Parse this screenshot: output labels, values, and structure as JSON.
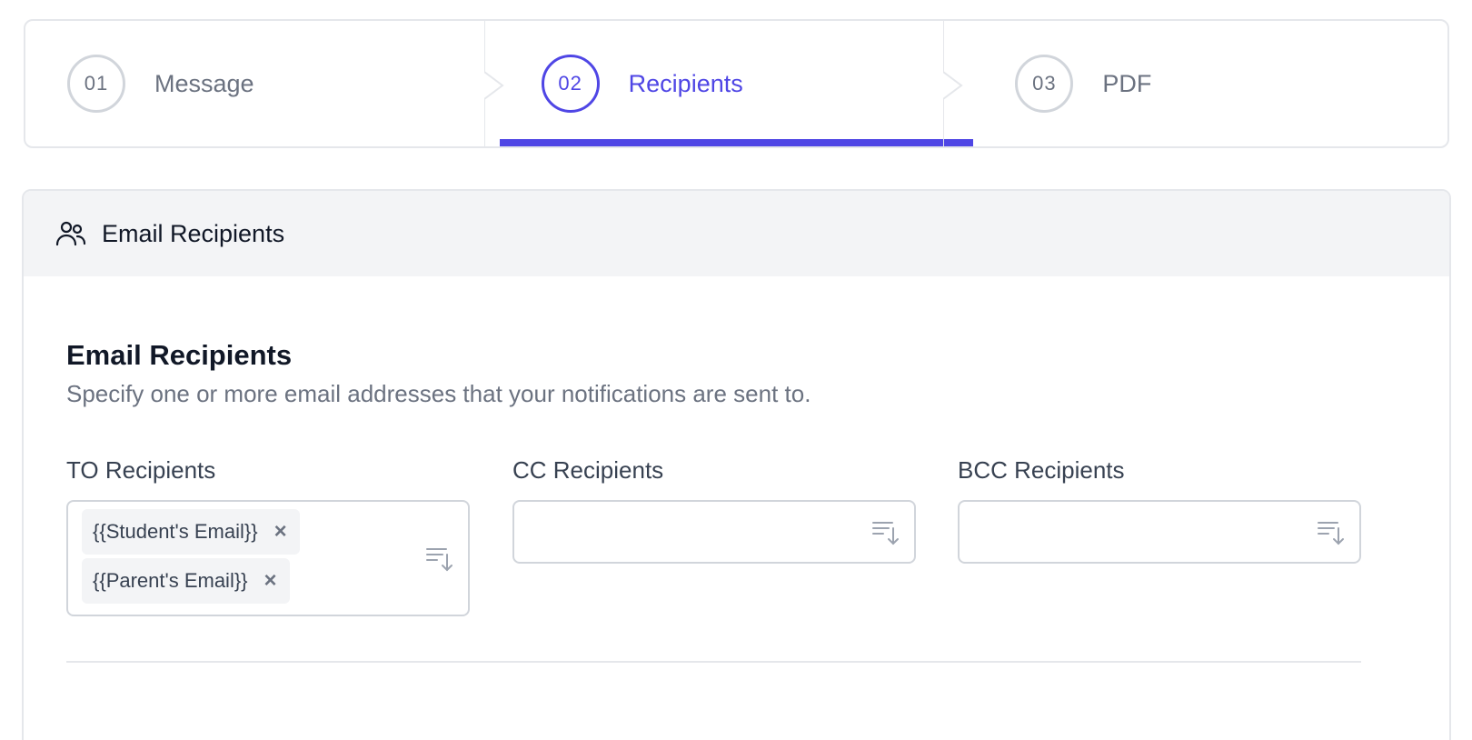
{
  "stepper": {
    "steps": [
      {
        "number": "01",
        "label": "Message",
        "active": false
      },
      {
        "number": "02",
        "label": "Recipients",
        "active": true
      },
      {
        "number": "03",
        "label": "PDF",
        "active": false
      }
    ],
    "accent_color": "#4f46e5"
  },
  "panel": {
    "header_icon": "users-icon",
    "header_title": "Email Recipients",
    "section_title": "Email Recipients",
    "section_description": "Specify one or more email addresses that your notifications are sent to."
  },
  "fields": {
    "to": {
      "label": "TO Recipients",
      "chips": [
        "{{Student's Email}}",
        "{{Parent's Email}}"
      ],
      "remove_icon": "close-icon",
      "sort_icon": "sort-descending-icon"
    },
    "cc": {
      "label": "CC Recipients",
      "chips": [],
      "sort_icon": "sort-descending-icon"
    },
    "bcc": {
      "label": "BCC Recipients",
      "chips": [],
      "sort_icon": "sort-descending-icon"
    }
  }
}
